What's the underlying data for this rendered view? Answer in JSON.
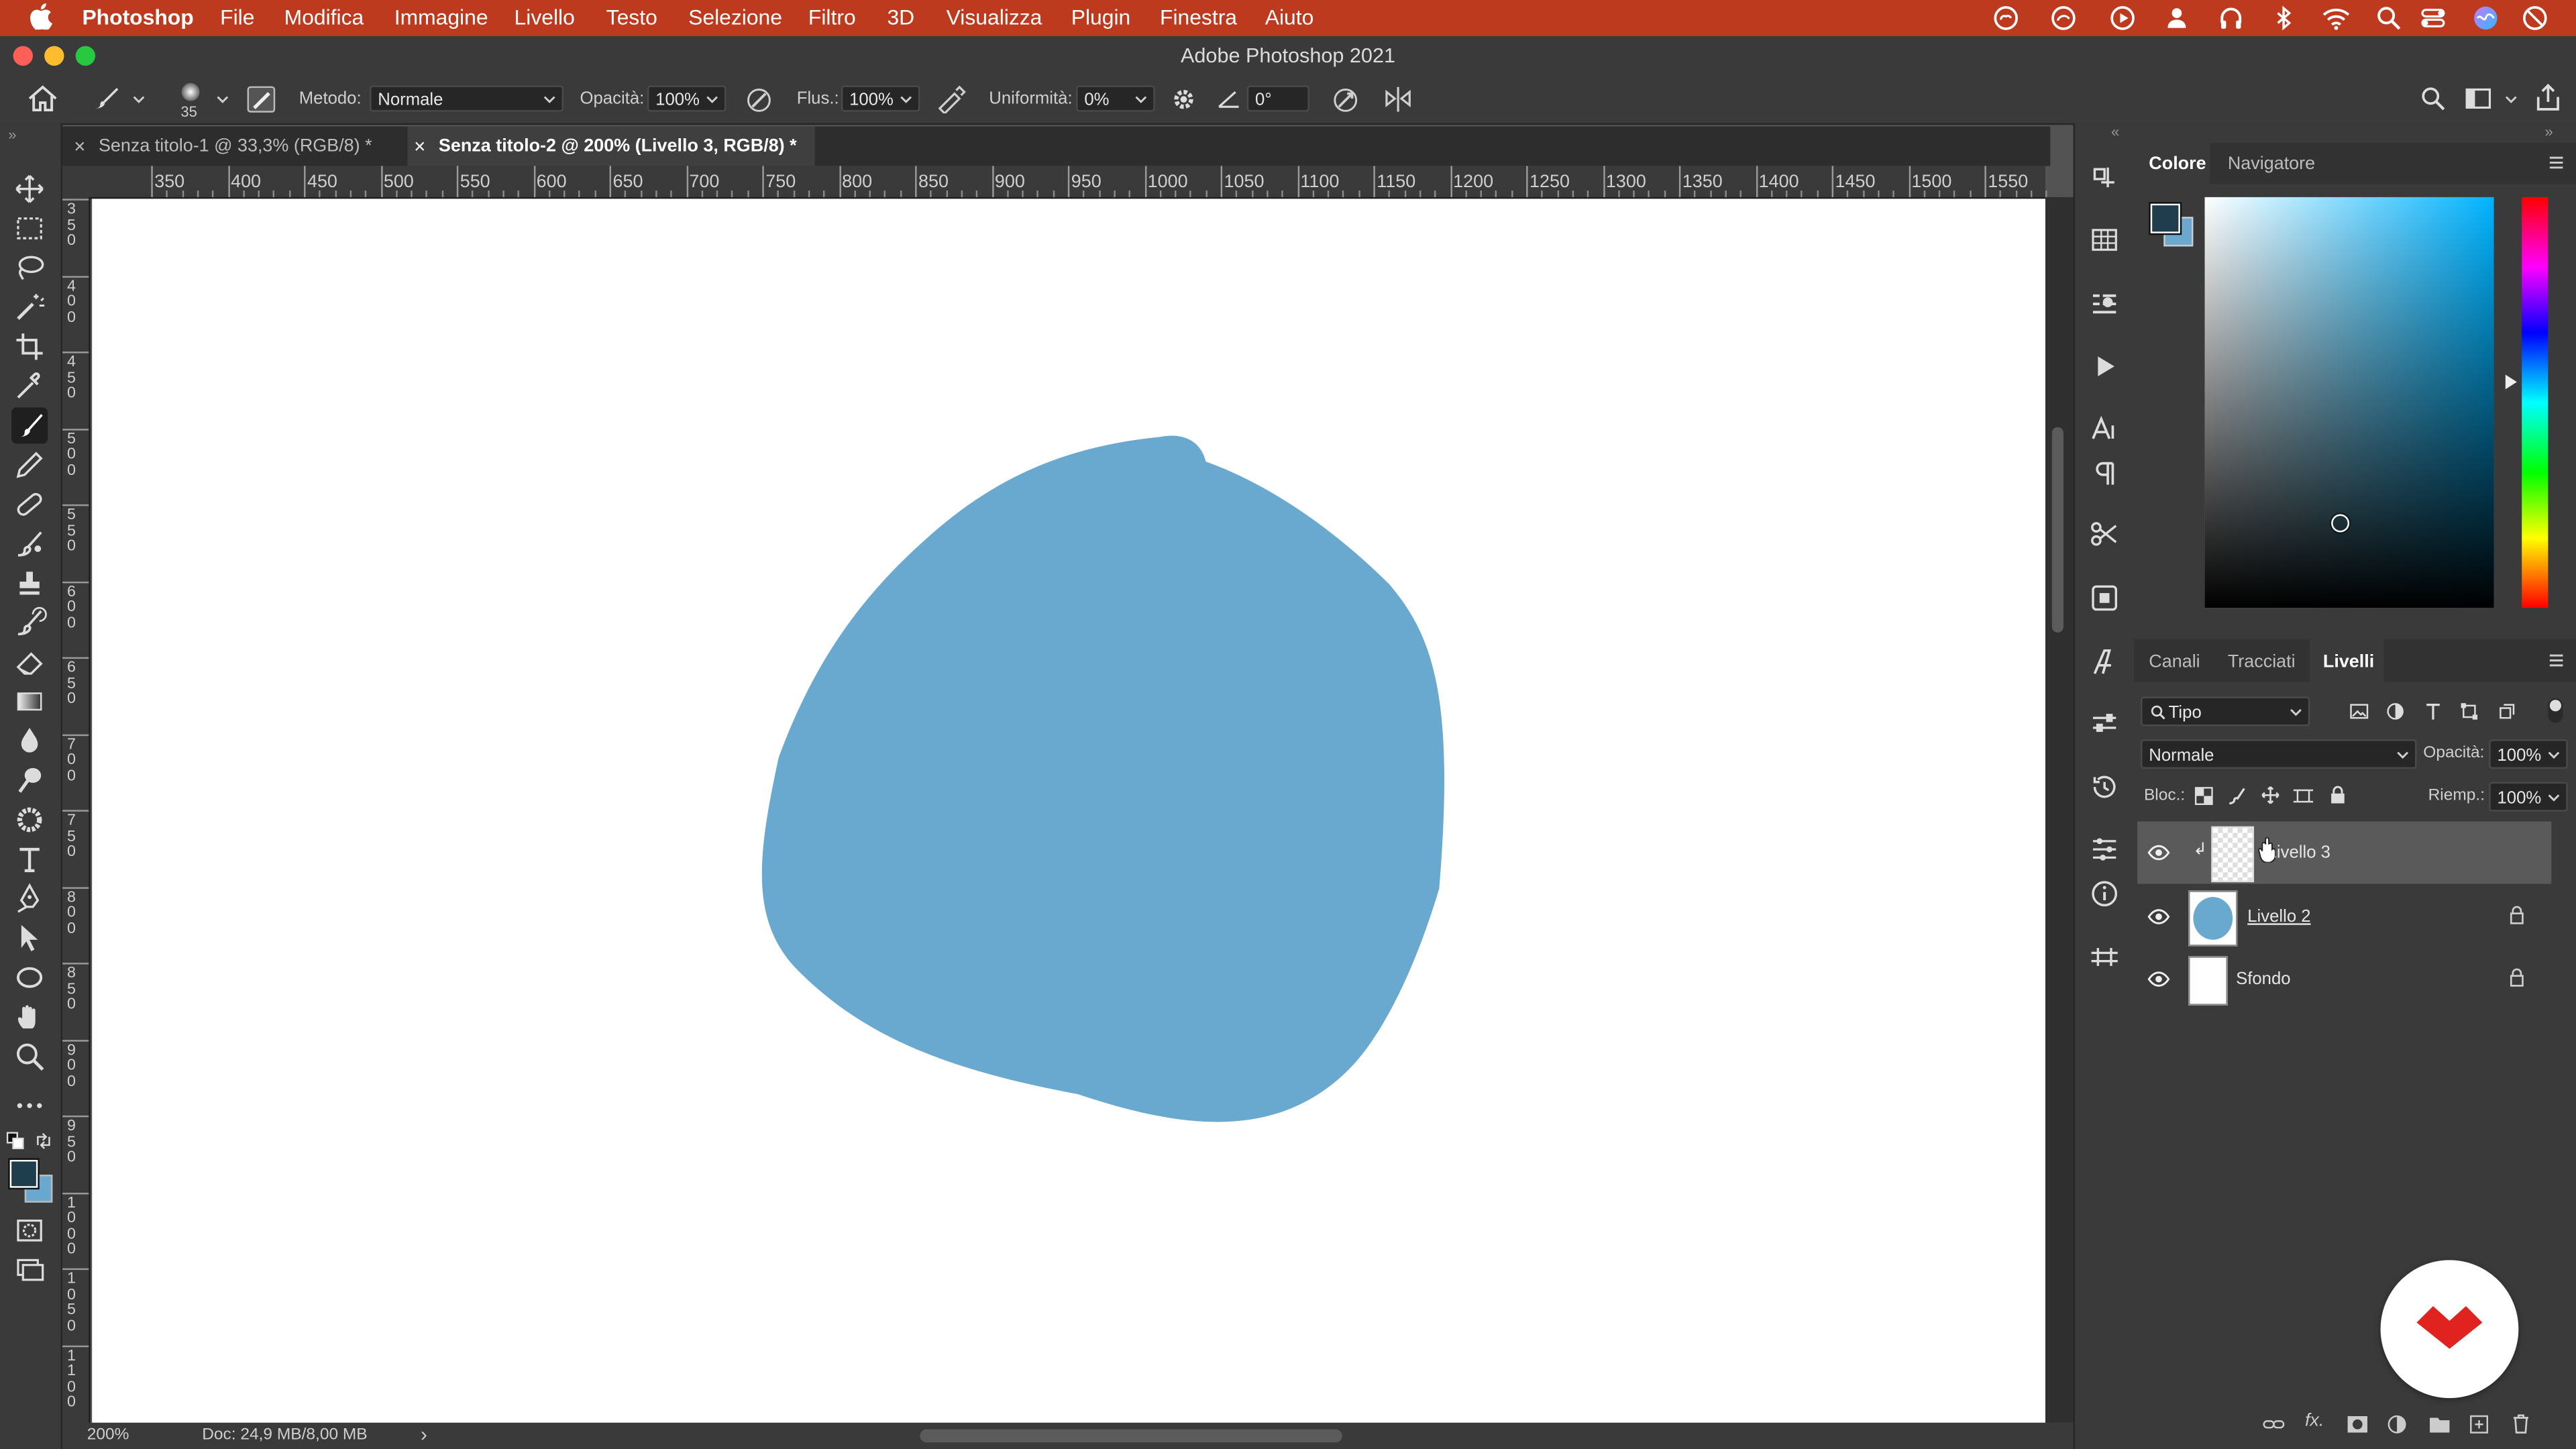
{
  "menubar": {
    "app_name": "Photoshop",
    "items": [
      "File",
      "Modifica",
      "Immagine",
      "Livello",
      "Testo",
      "Selezione",
      "Filtro",
      "3D",
      "Visualizza",
      "Plugin",
      "Finestra",
      "Aiuto"
    ]
  },
  "window": {
    "title": "Adobe Photoshop 2021"
  },
  "options": {
    "brush_size": "35",
    "mode_label": "Metodo:",
    "mode_value": "Normale",
    "opacity_label": "Opacità:",
    "opacity_value": "100%",
    "flow_label": "Flus.:",
    "flow_value": "100%",
    "smoothing_label": "Uniformità:",
    "smoothing_value": "0%",
    "angle_value": "0°"
  },
  "tabs": [
    {
      "label": "Senza titolo-1 @ 33,3% (RGB/8) *",
      "active": false
    },
    {
      "label": "Senza titolo-2 @ 200% (Livello 3, RGB/8) *",
      "active": true
    }
  ],
  "ruler": {
    "h_ticks": [
      "350",
      "400",
      "450",
      "500",
      "550",
      "600",
      "650",
      "700",
      "750",
      "800",
      "850",
      "900",
      "950",
      "1000",
      "1050",
      "1100",
      "1150",
      "1200",
      "1250",
      "1300",
      "1350",
      "1400",
      "1450",
      "1500",
      "1550"
    ],
    "v_ticks": [
      "350",
      "400",
      "450",
      "500",
      "550",
      "600",
      "650",
      "700",
      "750",
      "800",
      "850",
      "900",
      "950",
      "1000",
      "1050",
      "1100"
    ]
  },
  "status": {
    "zoom": "200%",
    "doc": "Doc: 24,9 MB/8,00 MB"
  },
  "colors": {
    "foreground": "#1f3d4d",
    "background": "#6aa8cf",
    "blob": "#6aa9cf",
    "menubar": "#bd3a1f",
    "accent": "#e0231e"
  },
  "color_panel": {
    "tabs": [
      "Colore",
      "Navigatore"
    ],
    "active": "Colore"
  },
  "layers_panel": {
    "tabs": [
      "Canali",
      "Tracciati",
      "Livelli"
    ],
    "active": "Livelli",
    "filter_label": "Tipo",
    "blend_mode": "Normale",
    "opacity_label": "Opacità:",
    "opacity_value": "100%",
    "lock_label": "Bloc.:",
    "fill_label": "Riemp.:",
    "fill_value": "100%",
    "layers": [
      {
        "name": "Livello 3",
        "selected": true,
        "thumbnail": "transparent"
      },
      {
        "name": "Livello 2",
        "selected": false,
        "thumbnail": "blue-circle"
      },
      {
        "name": "Sfondo",
        "selected": false,
        "thumbnail": "white"
      }
    ]
  }
}
